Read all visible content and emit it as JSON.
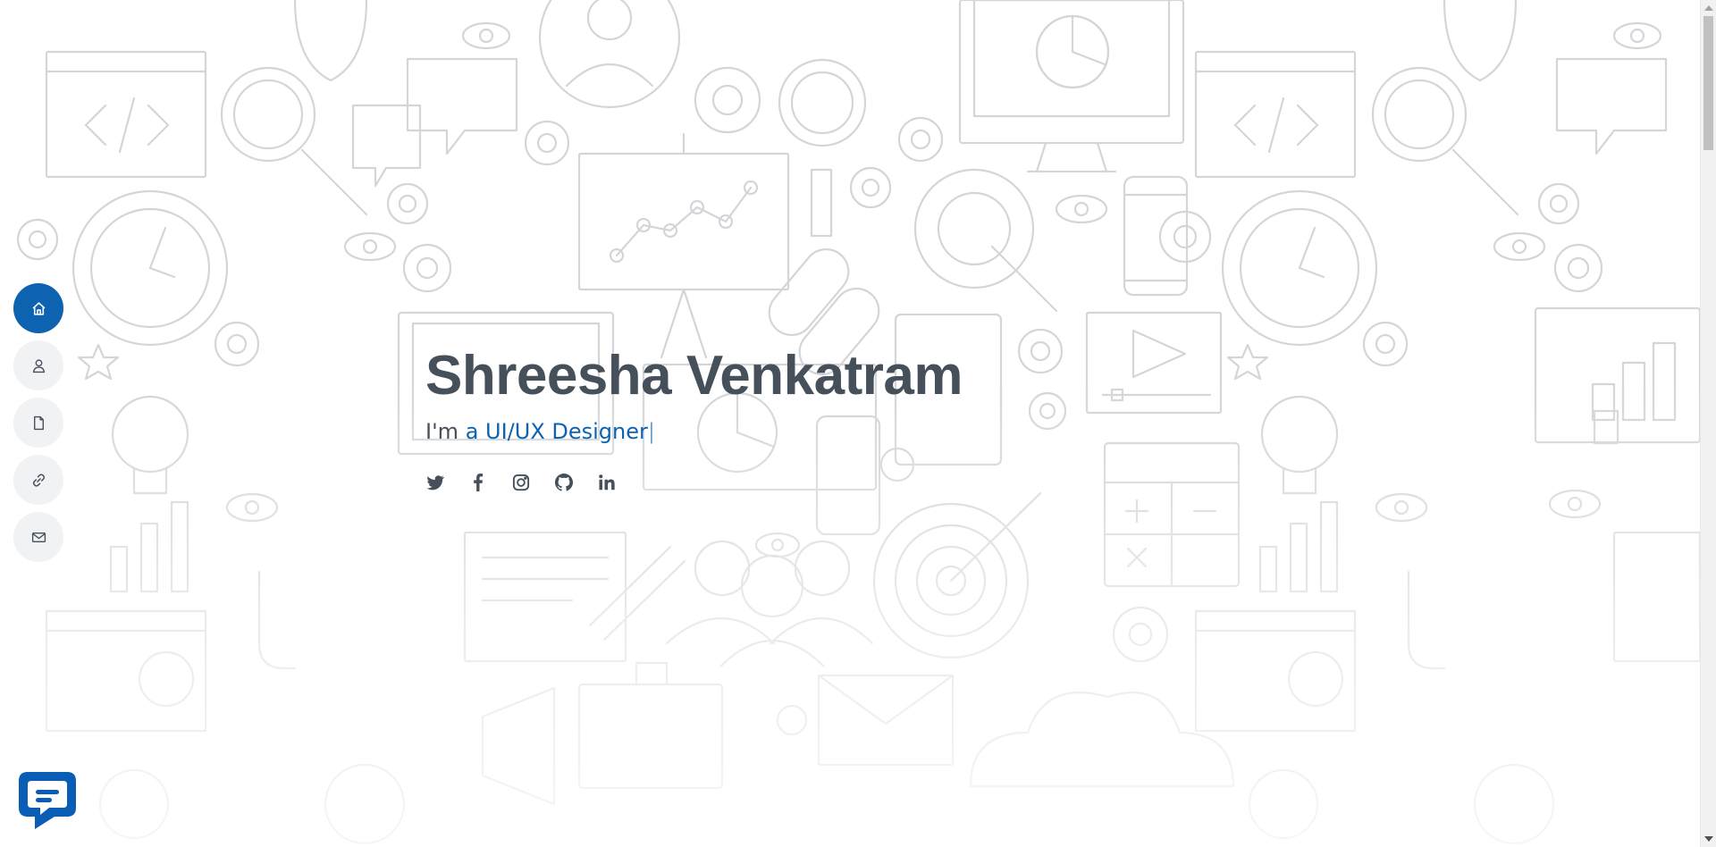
{
  "hero": {
    "name": "Shreesha Venkatram",
    "intro": "I'm ",
    "role": "a UI/UX Designer",
    "cursor": "|"
  },
  "nav": {
    "items": [
      {
        "name": "home",
        "icon": "home-icon",
        "active": true
      },
      {
        "name": "about",
        "icon": "person-icon",
        "active": false
      },
      {
        "name": "resume",
        "icon": "file-icon",
        "active": false
      },
      {
        "name": "links",
        "icon": "link-icon",
        "active": false
      },
      {
        "name": "contact",
        "icon": "envelope-icon",
        "active": false
      }
    ]
  },
  "socials": [
    "twitter-icon",
    "facebook-icon",
    "instagram-icon",
    "github-icon",
    "linkedin-icon"
  ],
  "chat": {
    "icon": "chat-bubble-icon"
  },
  "colors": {
    "accent": "#0d63b0",
    "text": "#45505b",
    "nav_bg": "#f1f2f4",
    "pattern": "#d5d7da"
  }
}
